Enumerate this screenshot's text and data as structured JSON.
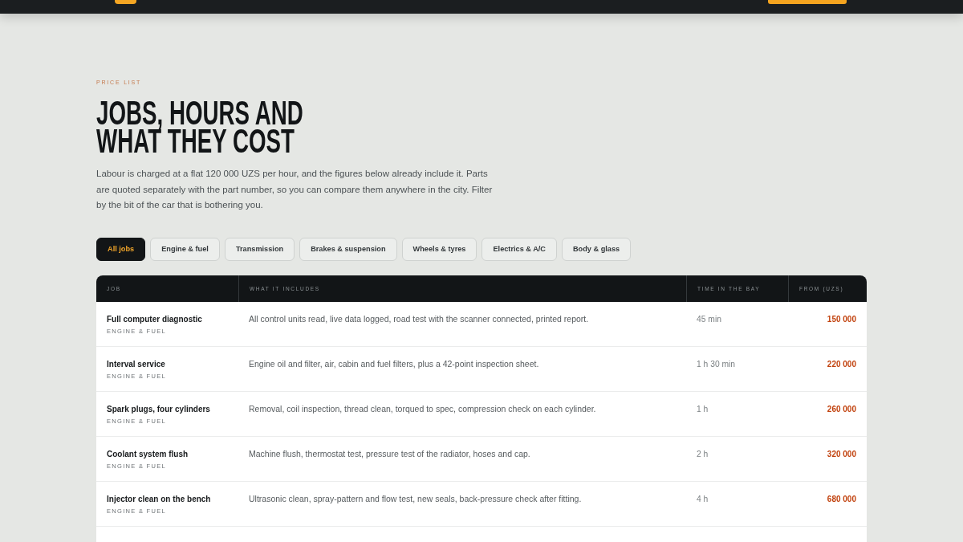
{
  "eyebrow": "PRICE LIST",
  "heading": "JOBS, HOURS AND WHAT THEY COST",
  "intro": "Labour is charged at a flat 120 000 UZS per hour, and the figures below already include it. Parts are quoted separately with the part number, so you can compare them anywhere in the city. Filter by the bit of the car that is bothering you.",
  "filters": [
    {
      "label": "All jobs",
      "selected": true
    },
    {
      "label": "Engine & fuel",
      "selected": false
    },
    {
      "label": "Transmission",
      "selected": false
    },
    {
      "label": "Brakes & suspension",
      "selected": false
    },
    {
      "label": "Wheels & tyres",
      "selected": false
    },
    {
      "label": "Electrics & A/C",
      "selected": false
    },
    {
      "label": "Body & glass",
      "selected": false
    }
  ],
  "table": {
    "columns": [
      "JOB",
      "WHAT IT INCLUDES",
      "TIME IN THE BAY",
      "FROM (UZS)"
    ],
    "rows": [
      {
        "job": "Full computer diagnostic",
        "category": "ENGINE & FUEL",
        "includes": "All control units read, live data logged, road test with the scanner connected, printed report.",
        "time": "45 min",
        "price": "150 000"
      },
      {
        "job": "Interval service",
        "category": "ENGINE & FUEL",
        "includes": "Engine oil and filter, air, cabin and fuel filters, plus a 42-point inspection sheet.",
        "time": "1 h 30 min",
        "price": "220 000"
      },
      {
        "job": "Spark plugs, four cylinders",
        "category": "ENGINE & FUEL",
        "includes": "Removal, coil inspection, thread clean, torqued to spec, compression check on each cylinder.",
        "time": "1 h",
        "price": "260 000"
      },
      {
        "job": "Coolant system flush",
        "category": "ENGINE & FUEL",
        "includes": "Machine flush, thermostat test, pressure test of the radiator, hoses and cap.",
        "time": "2 h",
        "price": "320 000"
      },
      {
        "job": "Injector clean on the bench",
        "category": "ENGINE & FUEL",
        "includes": "Ultrasonic clean, spray-pattern and flow test, new seals, back-pressure check after fitting.",
        "time": "4 h",
        "price": "680 000"
      }
    ]
  }
}
